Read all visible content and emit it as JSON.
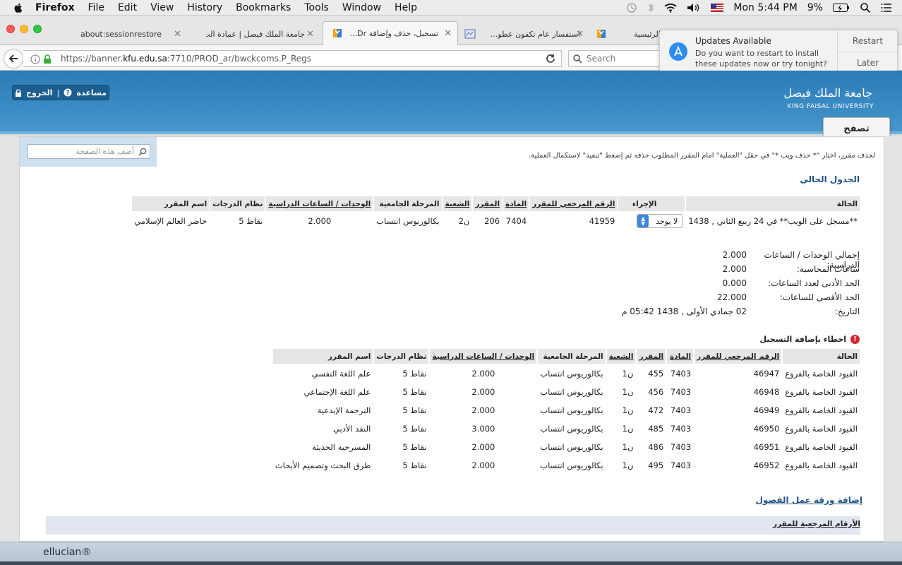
{
  "menubar": {
    "app": "Firefox",
    "items": [
      "File",
      "Edit",
      "View",
      "History",
      "Bookmarks",
      "Tools",
      "Window",
      "Help"
    ],
    "battery": "9%",
    "clock": "Mon 5:44 PM"
  },
  "tabs": [
    {
      "label": "about:sessionrestore"
    },
    {
      "label": "جامعة الملك فيصل | عمادة الت..."
    },
    {
      "label": "تسجيل، حذف وإضافة Dr..."
    },
    {
      "label": "استفسار عام تكفون عطو..."
    },
    {
      "label": "الرئيسية"
    }
  ],
  "navbar": {
    "url_prefix": "https://banner.",
    "url_domain": "kfu.edu.sa",
    "url_suffix": ":7710/PROD_ar/bwckcoms.P_Regs",
    "search_placeholder": "Search"
  },
  "notification": {
    "title": "Updates Available",
    "body": "Do you want to restart to install these updates now or try tonight?",
    "restart": "Restart",
    "later": "Later"
  },
  "header": {
    "logout": "الخروج",
    "help": "مساعدة",
    "university_ar": "جامعة الملك فيصل",
    "university_en": "KING FAISAL UNIVERSITY",
    "browse_tab": "تصفح"
  },
  "page": {
    "search_placeholder": "أضف هذه الصفحة",
    "instructions": "لحذف مقرر، اختار \"* حذف ويب *\" في حقل \"العملية\" امام المقرر المطلوب حذفه ثم إضغط \"تنفيذ\" لاستكمال العملية.",
    "current_schedule_title": "الجدول الحالي",
    "current_headers": [
      "الحالة",
      "الإجراء",
      "الرقم المرجعي للمقرر",
      "المادة",
      "المقرر",
      "الشعبة",
      "المرحلة الجامعية",
      "الوحدات / الساعات الدراسية",
      "نظام الدرجات",
      "اسم المقرر"
    ],
    "current_row": {
      "status": "**مسجل على الويب** في 24 ربيع الثاني , 1438",
      "action": "لا يوجد",
      "crn": "41959",
      "subject": "7404",
      "course": "206",
      "section": "ن2",
      "level": "بكالوريوس انتساب",
      "units": "2.000",
      "grading": "نقاط 5",
      "title": "حاضر العالم الإسلامي"
    },
    "summary": [
      {
        "label": "إجمالي الوحدات / الساعات الدراسية:",
        "value": "2.000"
      },
      {
        "label": "ساعات المحاسبة:",
        "value": "2.000"
      },
      {
        "label": "الحد الأدنى لعدد الساعات:",
        "value": "0.000"
      },
      {
        "label": "الحد الأقصى للساعات:",
        "value": "22.000"
      },
      {
        "label": "التاريخ:",
        "value": "02 جمادي الأولى , 1438 05:42 م"
      }
    ],
    "errors_title": "اخطاء بإضافة التسجيل",
    "error_headers": [
      "الحالة",
      "الرقم المرجعي للمقرر",
      "المادة",
      "المقرر",
      "الشعبة",
      "المرحلة الجامعية",
      "الوحدات / الساعات الدراسية",
      "نظام الدرجات",
      "اسم المقرر"
    ],
    "error_rows": [
      {
        "status": "القيود الخاصة بالفروع",
        "crn": "46947",
        "subject": "7403",
        "course": "455",
        "section": "ن1",
        "level": "بكالوريوس انتساب",
        "units": "2.000",
        "grading": "نقاط 5",
        "title": "علم اللغة النفسي"
      },
      {
        "status": "القيود الخاصة بالفروع",
        "crn": "46948",
        "subject": "7403",
        "course": "456",
        "section": "ن1",
        "level": "بكالوريوس انتساب",
        "units": "2.000",
        "grading": "نقاط 5",
        "title": "علم اللغة الإجتماعي"
      },
      {
        "status": "القيود الخاصة بالفروع",
        "crn": "46949",
        "subject": "7403",
        "course": "472",
        "section": "ن1",
        "level": "بكالوريوس انتساب",
        "units": "2.000",
        "grading": "نقاط 5",
        "title": "الترجمة الإبدعية"
      },
      {
        "status": "القيود الخاصة بالفروع",
        "crn": "46950",
        "subject": "7403",
        "course": "485",
        "section": "ن1",
        "level": "بكالوريوس انتساب",
        "units": "3.000",
        "grading": "نقاط 5",
        "title": "النقد الأدبي"
      },
      {
        "status": "القيود الخاصة بالفروع",
        "crn": "46951",
        "subject": "7403",
        "course": "486",
        "section": "ن1",
        "level": "بكالوريوس انتساب",
        "units": "2.000",
        "grading": "نقاط 5",
        "title": "المسرحية الحديثة"
      },
      {
        "status": "القيود الخاصة بالفروع",
        "crn": "46952",
        "subject": "7403",
        "course": "495",
        "section": "ن1",
        "level": "بكالوريوس انتساب",
        "units": "2.000",
        "grading": "نقاط 5",
        "title": "طرق البحث وتصميم الأبحاث"
      }
    ],
    "worksheet_title": "إضافة ورقة عمل الفصول",
    "worksheet_header": "الأرقام المرجعية للمقرر"
  },
  "footer": {
    "brand": "ellucian®"
  },
  "colors": {
    "header_blue": "#2c7bb4",
    "link_blue": "#23568a",
    "error_red": "#d8232a"
  }
}
